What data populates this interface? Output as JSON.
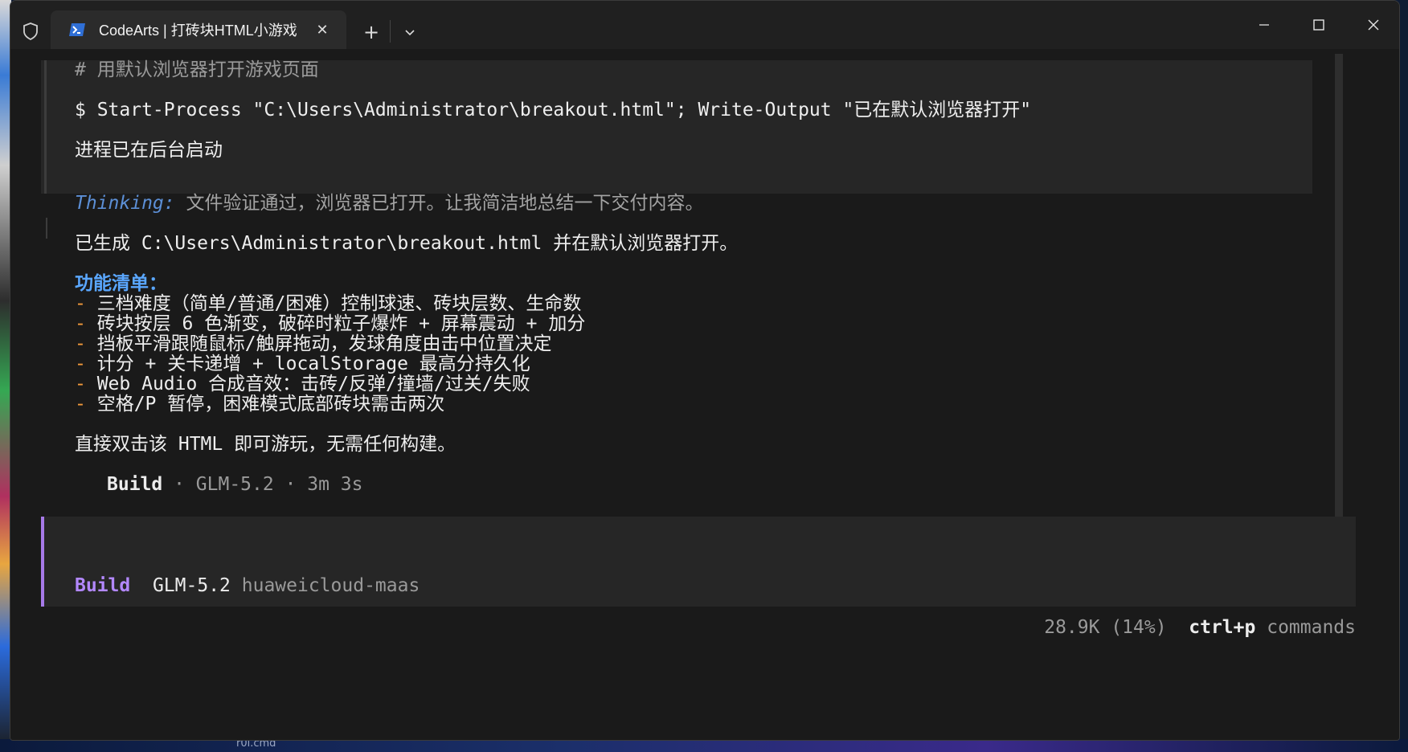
{
  "window": {
    "tab_title": "CodeArts | 打砖块HTML小游戏",
    "icons": {
      "shield": "shield-icon",
      "terminal": "powershell-icon",
      "close_tab": "close-icon",
      "new_tab": "plus-icon",
      "dropdown": "chevron-down-icon",
      "minimize": "minimize-icon",
      "maximize": "maximize-icon",
      "close": "close-icon"
    },
    "new_tab_glyph": "+",
    "close_glyph": "✕"
  },
  "tool_output": {
    "comment": "# 用默认浏览器打开游戏页面",
    "command": "$ Start-Process \"C:\\Users\\Administrator\\breakout.html\"; Write-Output \"已在默认浏览器打开\"",
    "result": "进程已在后台启动"
  },
  "thinking": {
    "label": "Thinking:",
    "text": " 文件验证通过，浏览器已打开。让我简洁地总结一下交付内容。"
  },
  "response": {
    "summary": "已生成 C:\\Users\\Administrator\\breakout.html 并在默认浏览器打开。",
    "features_title": "功能清单：",
    "dash": "- ",
    "features": [
      "三档难度（简单/普通/困难）控制球速、砖块层数、生命数",
      "砖块按层 6 色渐变，破碎时粒子爆炸 + 屏幕震动 + 加分",
      "挡板平滑跟随鼠标/触屏拖动，发球角度由击中位置决定",
      "计分 + 关卡递增 + localStorage 最高分持久化",
      "Web Audio 合成音效：击砖/反弹/撞墙/过关/失败",
      "空格/P 暂停，困难模式底部砖块需击两次"
    ],
    "closing": "直接双击该 HTML 即可游玩，无需任何构建。"
  },
  "build_footer": {
    "name": "Build",
    "meta": " · GLM-5.2 · 3m 3s"
  },
  "input": {
    "mode": "Build",
    "model": "GLM-5.2",
    "provider": "huaweicloud-maas"
  },
  "status": {
    "tokens": "28.9K (14%)",
    "keys": "ctrl+p",
    "commands": "commands"
  },
  "desktop": {
    "taskbar_text": "r0i.cmd"
  },
  "colors": {
    "accent_purple": "#b388ff",
    "thinking_blue": "#5c8fd6",
    "title_blue": "#5aa7ff",
    "dash_orange": "#f39a3a"
  }
}
